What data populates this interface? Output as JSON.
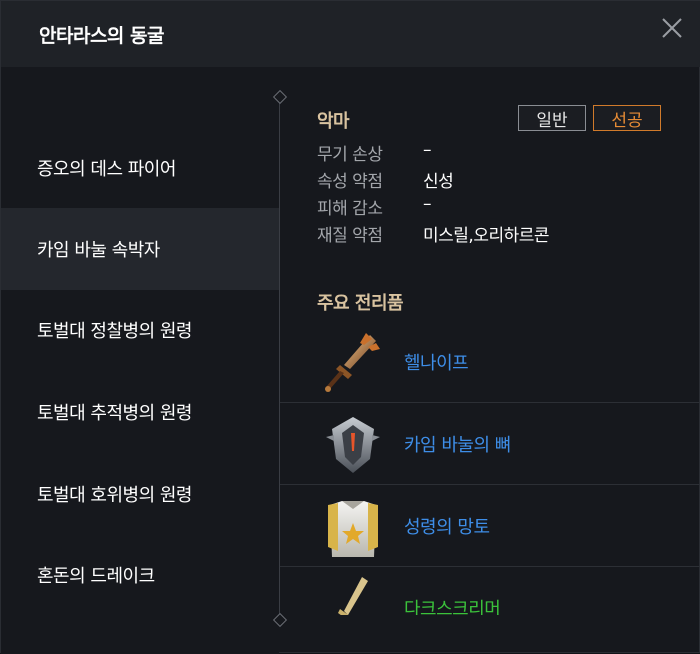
{
  "window": {
    "title": "안타라스의 동굴"
  },
  "sidebar": {
    "items": [
      {
        "label": "증오의 데스 파이어"
      },
      {
        "label": "카임 바눌 속박자"
      },
      {
        "label": "토벌대 정찰병의 원령"
      },
      {
        "label": "토벌대 추적병의 원령"
      },
      {
        "label": "토벌대 호위병의 원령"
      },
      {
        "label": "혼돈의 드레이크"
      }
    ],
    "active_index": 1
  },
  "detail": {
    "type_label": "악마",
    "buttons": {
      "normal": "일반",
      "hard": "선공"
    },
    "stats": [
      {
        "label": "무기 손상",
        "value": "–"
      },
      {
        "label": "속성 약점",
        "value": "신성"
      },
      {
        "label": "피해 감소",
        "value": "–"
      },
      {
        "label": "재질 약점",
        "value": "미스릴,오리하르콘"
      }
    ],
    "loot_title": "주요 전리품",
    "loot": [
      {
        "name": "헬나이프",
        "icon": "dagger-icon",
        "color": "#3e8ee8"
      },
      {
        "name": "카임 바눌의 뼈",
        "icon": "shield-icon",
        "color": "#3e8ee8"
      },
      {
        "name": "성령의 망토",
        "icon": "cloak-icon",
        "color": "#3e8ee8"
      },
      {
        "name": "다크스크리머",
        "icon": "sword-icon",
        "color": "#3bc23b"
      }
    ]
  },
  "colors": {
    "accent_orange": "#e88c35",
    "section_title": "#d9c3a0",
    "rare_item": "#3e8ee8",
    "uncommon_item": "#3bc23b"
  }
}
